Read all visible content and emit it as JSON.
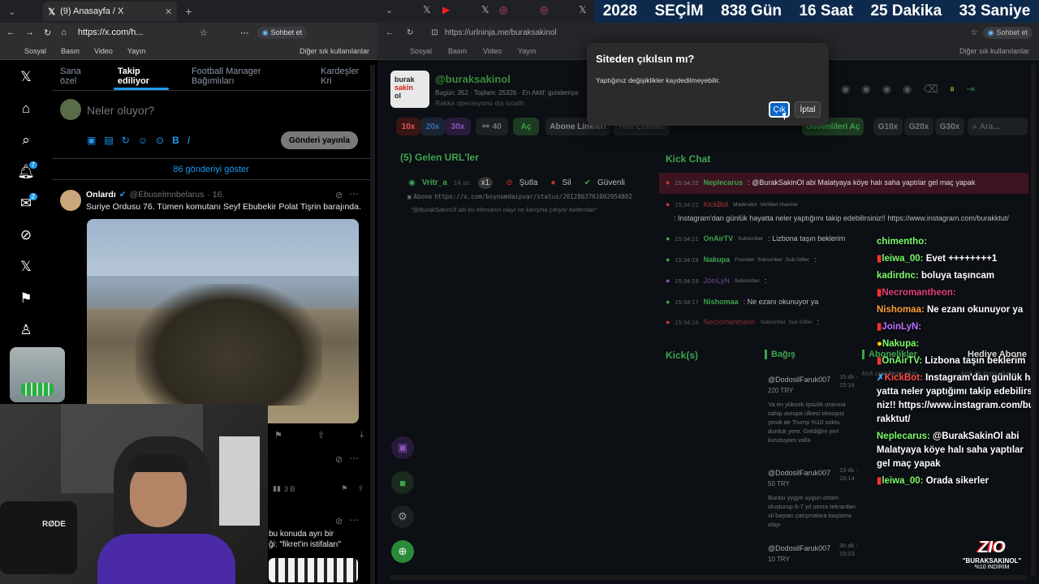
{
  "left_browser": {
    "tab_title": "(9) Anasayfa / X",
    "url": "https://x.com/h...",
    "chat_button": "Sohbet et",
    "favorites": [
      "Sosyal",
      "Basın",
      "Video",
      "Yayın"
    ],
    "favorites_other": "Diğer sık kullanılanlar"
  },
  "x": {
    "tabs": [
      "Sana özel",
      "Takip ediliyor",
      "Football Manager Bağımlıları",
      "Kardeşler Kri"
    ],
    "compose_placeholder": "Neler oluyor?",
    "post_button": "Gönderi yayınla",
    "show_more": "86 gönderiyi göster",
    "tweet": {
      "name": "Onlardı",
      "handle": "@Ebuselmnbelarus",
      "time": "· 16.",
      "text": "Suriye Ordusu 76. Tümen komutanı Seyf Ebubekir Polat Tişrin barajında."
    },
    "views": "3 B",
    "notif_count": "7",
    "msg_count": "2",
    "tweet2_line1": "bu konuda ayrı bir",
    "tweet2_line2": "ği: \"fikret'in istifaları\""
  },
  "webcam": {
    "brand": "RØDE"
  },
  "right_browser": {
    "url": "https://urlninja.me/buraksakinol",
    "chat_button": "Sohbet et",
    "favorites": [
      "Sosyal",
      "Basın",
      "Video",
      "Yayın"
    ],
    "favorites_other": "Diğer sık kullanılanlar"
  },
  "countdown": {
    "year": "2028",
    "label": "SEÇİM",
    "days": "838 Gün",
    "hours": "16 Saat",
    "minutes": "25 Dakika",
    "seconds": "33 Saniye"
  },
  "profile": {
    "handle": "@buraksakinol",
    "logo_line1": "burak",
    "logo_line2": "sakin",
    "logo_line3": "ol",
    "stats": "Bugün: 352  ·  Toplam: 25326  ·  En Aktif: gundemya",
    "subtitle": "Rakka operasyonu dış ivraith"
  },
  "controls": {
    "mult": [
      "10x",
      "20x",
      "30x"
    ],
    "count": "40",
    "open": "Aç",
    "subscriber_links": "Abone Linkleri",
    "video_links": "Yeni Linkleri",
    "g_buttons": [
      "G10x",
      "G20x",
      "G30x"
    ],
    "search_placeholder": "Ara...",
    "trusted_open": "Güvenlileri Aç"
  },
  "incoming": {
    "title": "(5) Gelen URL'ler",
    "user": "Vritr_a",
    "time": "14 sn.",
    "badge": "x1",
    "actions": [
      "Şutla",
      "Sil",
      "Güvenli"
    ],
    "link_label": "Abone",
    "link": "https://x.com/boynumdaipvar/status/2012863761002954802",
    "message": "\"@BurakSakinOl abi bu elemanın olayı ne karışma çıkıyor twitterdan\""
  },
  "kick_chat": {
    "title": "Kick Chat",
    "lines": [
      {
        "time": "15:34:22",
        "user": "Neplecarus",
        "badges": "",
        "text": ": @BurakSakinOl abi Malatyaya köye halı saha yaptılar gel maç yapak"
      },
      {
        "time": "15:34:22",
        "user": "KickBot",
        "badges": "Moderator  Verified channel",
        "text": ""
      },
      {
        "time": "",
        "user": "",
        "badges": "",
        "text": ": Instagram'dan günlük hayatta neler yaptığımı takip edebilirsiniz!! https://www.instagram.com/burakktut/"
      },
      {
        "time": "15:34:21",
        "user": "OnAirTV",
        "badges": "Subscriber",
        "text": ": Lizbona taşın beklerim"
      },
      {
        "time": "15:34:19",
        "user": "Nakupa",
        "badges": "Founder  Subscriber  Sub Gifter",
        "text": ":"
      },
      {
        "time": "15:34:18",
        "user": "JoinLyN",
        "badges": "Subscriber",
        "text": ":"
      },
      {
        "time": "15:34:17",
        "user": "Nishomaa",
        "badges": "",
        "text": ": Ne ezanı okunuyor ya"
      },
      {
        "time": "15:34:16",
        "user": "Necromantheon",
        "badges": "Subscriber  Sub Gifter",
        "text": ":"
      }
    ]
  },
  "kicks": {
    "title": "Kick(s)",
    "donate_title": "Bağış",
    "sub_title": "Abonelikler",
    "gift_title": "Hediye Abone",
    "sub_note": "kick.com/login olun",
    "gift_note": "kick.de login olun",
    "items": [
      {
        "user": "@DodosilFaruk007",
        "amount": "220 TRY",
        "time": "15 dk - 15:18",
        "text": "Ya en yüksek işsizlik oranına sahip avrupa ülkesi olmuşuz şimdi de Trump %10 soktu durduk yere. Geldiğim yeri kurutuyom valla"
      },
      {
        "user": "@DodosilFaruk007",
        "amount": "50 TRY",
        "time": "19 dk - 15:14",
        "text": "Burası yygye uygun ortam oluşturup 6-7 yıl sonra tekrardan sil baştan çatışmalara başlama olayı"
      },
      {
        "user": "@DodosilFaruk007",
        "amount": "10 TRY",
        "time": "30 dk - 15:03",
        "text": ""
      }
    ]
  },
  "overlay_chat": [
    {
      "user": "chimenthо:",
      "text": "",
      "color": "#7cfc6a"
    },
    {
      "user": "leiwa_00:",
      "text": "Evet ++++++++1",
      "color": "#7cfc6a"
    },
    {
      "user": "kadirdnc:",
      "text": "boluya taşıncam",
      "color": "#7cfc6a"
    },
    {
      "user": "Necromantheon:",
      "text": "",
      "color": "#e0407a"
    },
    {
      "user": "Nishomaa:",
      "text": "Ne ezanı okunuyor ya",
      "color": "#ff9e3d"
    },
    {
      "user": "JoinLyN:",
      "text": "",
      "color": "#c070ff"
    },
    {
      "user": "Nakupa:",
      "text": "",
      "color": "#7cfc6a"
    },
    {
      "user": "OnAirTV:",
      "text": "Lizbona taşın beklerim",
      "color": "#7cfc6a"
    },
    {
      "user": "KickBot:",
      "text": "Instagram'dan günlük hayatta neler yaptığımı takip edebilirsiniz!! https://www.instagram.com/burakktut/",
      "color": "#ff4d4d"
    },
    {
      "user": "Neplecarus:",
      "text": "@BurakSakinOl abi Malatyaya köye halı saha yaptılar gel maç yapak",
      "color": "#7cfc6a"
    },
    {
      "user": "leiwa_00:",
      "text": "Orada sikerler",
      "color": "#7cfc6a"
    }
  ],
  "promo": {
    "brand": "ZIO",
    "code": "\"BURAKSAKINOL\"",
    "discount": "%10 İNDİRİM"
  },
  "dialog": {
    "title": "Siteden çıkılsın mı?",
    "message": "Yaptığınız değişiklikler kaydedilmeyebilir.",
    "confirm": "Çık",
    "cancel": "İptal"
  }
}
